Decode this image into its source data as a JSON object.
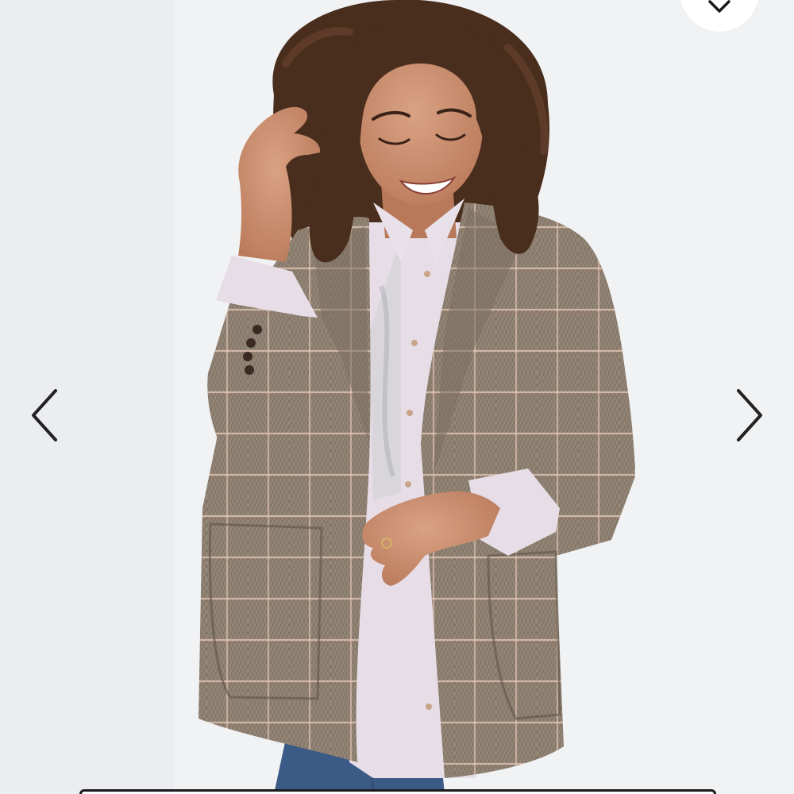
{
  "product_image": {
    "alt": "",
    "colors": {
      "background": "#f1f2f4",
      "jacket": "#8e8172",
      "jacket_dark": "#6f6458",
      "windowpane": "#e7c9b7",
      "shirt": "#e6dde6",
      "jeans": "#3b5a86",
      "hair": "#4a2e1d",
      "skin": "#c8906f"
    }
  },
  "navigation": {
    "prev_icon": "chevron-left-icon",
    "next_icon": "chevron-right-icon",
    "arrow_color": "#222222"
  },
  "favorite": {
    "icon": "heart-icon"
  },
  "scroll_indicator": {
    "color": "#1a1a1a"
  }
}
